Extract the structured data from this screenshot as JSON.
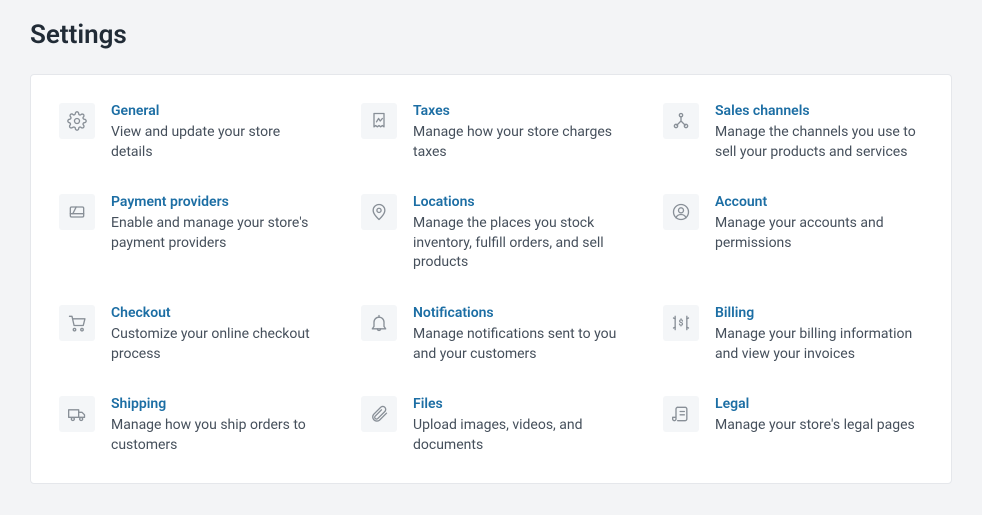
{
  "title": "Settings",
  "items": [
    {
      "id": "general",
      "title": "General",
      "desc": "View and update your store details",
      "icon": "gear"
    },
    {
      "id": "taxes",
      "title": "Taxes",
      "desc": "Manage how your store charges taxes",
      "icon": "receipt"
    },
    {
      "id": "sales-channels",
      "title": "Sales channels",
      "desc": "Manage the channels you use to sell your products and services",
      "icon": "channels"
    },
    {
      "id": "payment-providers",
      "title": "Payment providers",
      "desc": "Enable and manage your store's payment providers",
      "icon": "card"
    },
    {
      "id": "locations",
      "title": "Locations",
      "desc": "Manage the places you stock inventory, fulfill orders, and sell products",
      "icon": "location"
    },
    {
      "id": "account",
      "title": "Account",
      "desc": "Manage your accounts and permissions",
      "icon": "account"
    },
    {
      "id": "checkout",
      "title": "Checkout",
      "desc": "Customize your online checkout process",
      "icon": "cart"
    },
    {
      "id": "notifications",
      "title": "Notifications",
      "desc": "Manage notifications sent to you and your customers",
      "icon": "bell"
    },
    {
      "id": "billing",
      "title": "Billing",
      "desc": "Manage your billing information and view your invoices",
      "icon": "billing"
    },
    {
      "id": "shipping",
      "title": "Shipping",
      "desc": "Manage how you ship orders to customers",
      "icon": "truck"
    },
    {
      "id": "files",
      "title": "Files",
      "desc": "Upload images, videos, and documents",
      "icon": "clip"
    },
    {
      "id": "legal",
      "title": "Legal",
      "desc": "Manage your store's legal pages",
      "icon": "scroll"
    }
  ]
}
